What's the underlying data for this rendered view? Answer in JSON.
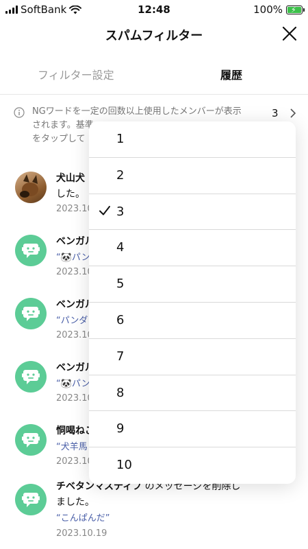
{
  "status_bar": {
    "carrier": "SoftBank",
    "time": "12:48",
    "battery": "100%"
  },
  "nav": {
    "title": "スパムフィルター"
  },
  "tabs": [
    {
      "label": "フィルター設定"
    },
    {
      "label": "履歴"
    }
  ],
  "notice": {
    "line1": "NGワードを一定の回数以上使用したメンバーが表示",
    "line2": "されます。基準",
    "line3": "をタップして",
    "count": "3"
  },
  "history": [
    {
      "name": "犬山犬",
      "line2": "した。",
      "date": "2023.10.",
      "avatar": "dog-photo"
    },
    {
      "name": "ベンガル",
      "quote": "“🐼パン",
      "date": "2023.10.",
      "avatar": "bot-icon"
    },
    {
      "name": "ベンガル",
      "quote": "“パンダ",
      "date": "2023.10.",
      "avatar": "bot-icon"
    },
    {
      "name": "ベンガル",
      "quote": "“🐼パン",
      "date": "2023.10.",
      "avatar": "bot-icon"
    },
    {
      "name": "恫喝ねこ",
      "quote": "“犬羊馬",
      "date": "2023.10.",
      "avatar": "bot-icon"
    },
    {
      "name": "チベタンマスティフ",
      "action": " のメッセージを削除し",
      "line2": "ました。",
      "quote": "“こんぱんだ”",
      "date": "2023.10.19",
      "avatar": "bot-icon"
    }
  ],
  "dropdown": {
    "options": [
      "1",
      "2",
      "3",
      "4",
      "5",
      "6",
      "7",
      "8",
      "9",
      "10"
    ],
    "selected": "3"
  },
  "colors": {
    "bot_avatar": "#5ccc96",
    "quote_text": "#4a5fa8",
    "battery_fill": "#3cc04a"
  }
}
